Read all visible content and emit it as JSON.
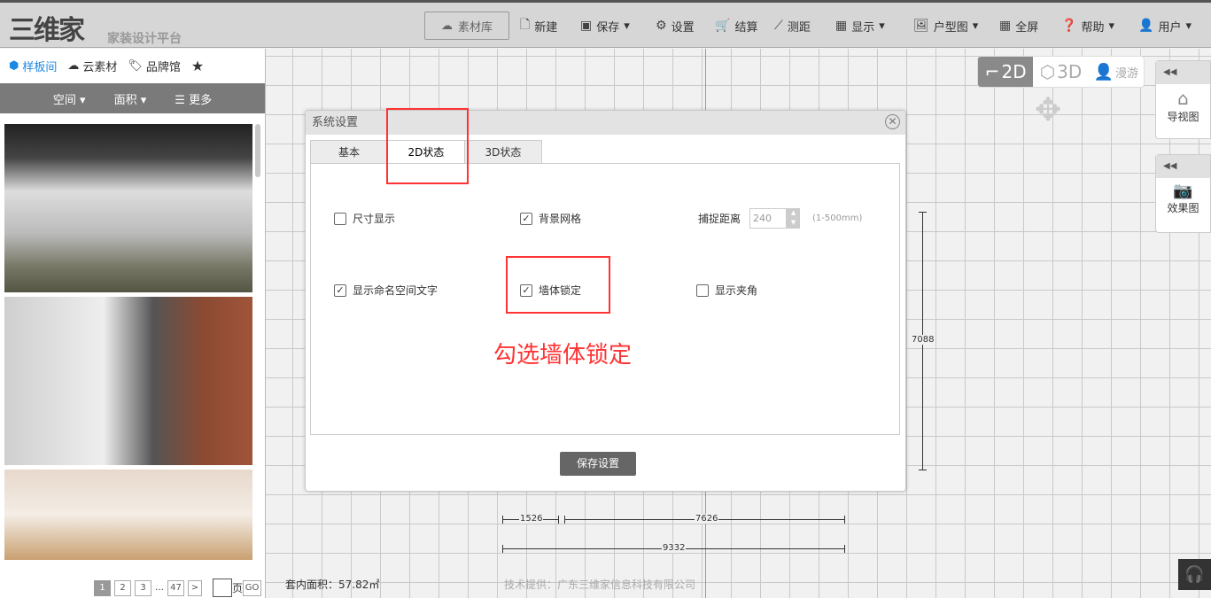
{
  "header": {
    "logo": "三维家",
    "subtitle": "家装设计平台",
    "material_lib": "素材库",
    "menu": [
      {
        "label": "新建",
        "icon": "file-icon"
      },
      {
        "label": "保存",
        "icon": "save-icon",
        "dropdown": true
      },
      {
        "label": "设置",
        "icon": "gear-icon"
      },
      {
        "label": "结算",
        "icon": "cart-icon"
      },
      {
        "label": "测距",
        "icon": "ruler-icon"
      },
      {
        "label": "显示",
        "icon": "grid-icon",
        "dropdown": true
      },
      {
        "label": "户型图",
        "icon": "image-icon",
        "dropdown": true
      },
      {
        "label": "全屏",
        "icon": "grid-icon"
      },
      {
        "label": "帮助",
        "icon": "help-icon",
        "dropdown": true
      },
      {
        "label": "用户",
        "icon": "user-icon",
        "dropdown": true
      }
    ]
  },
  "sidebar": {
    "tabs": [
      "样板间",
      "云素材",
      "品牌馆"
    ],
    "filters": [
      "空间",
      "面积",
      "更多"
    ],
    "pager": {
      "pages": [
        "1",
        "2",
        "3",
        "…",
        "47",
        ">"
      ],
      "page_unit": "页",
      "go": "GO"
    }
  },
  "dialog": {
    "title": "系统设置",
    "tabs": [
      "基本",
      "2D状态",
      "3D状态"
    ],
    "options": [
      {
        "label": "尺寸显示",
        "checked": false
      },
      {
        "label": "背景网格",
        "checked": true
      },
      {
        "label": "显示命名空间文字",
        "checked": true
      },
      {
        "label": "墙体锁定",
        "checked": true
      },
      {
        "label": "显示夹角",
        "checked": false
      }
    ],
    "snap_label": "捕捉距离",
    "snap_value": "240",
    "snap_range": "(1-500mm)",
    "save": "保存设置"
  },
  "annotation": "勾选墙体锁定",
  "view_modes": [
    "2D",
    "3D",
    "漫游"
  ],
  "right_panel": [
    {
      "label": "导视图"
    },
    {
      "label": "效果图"
    }
  ],
  "dimensions": {
    "d1": "1526",
    "d2": "7626",
    "d3": "9332",
    "d4": "7088"
  },
  "footer": {
    "area": "套内面积：57.82㎡",
    "credit": "技术提供：广东三维家信息科技有限公司"
  }
}
